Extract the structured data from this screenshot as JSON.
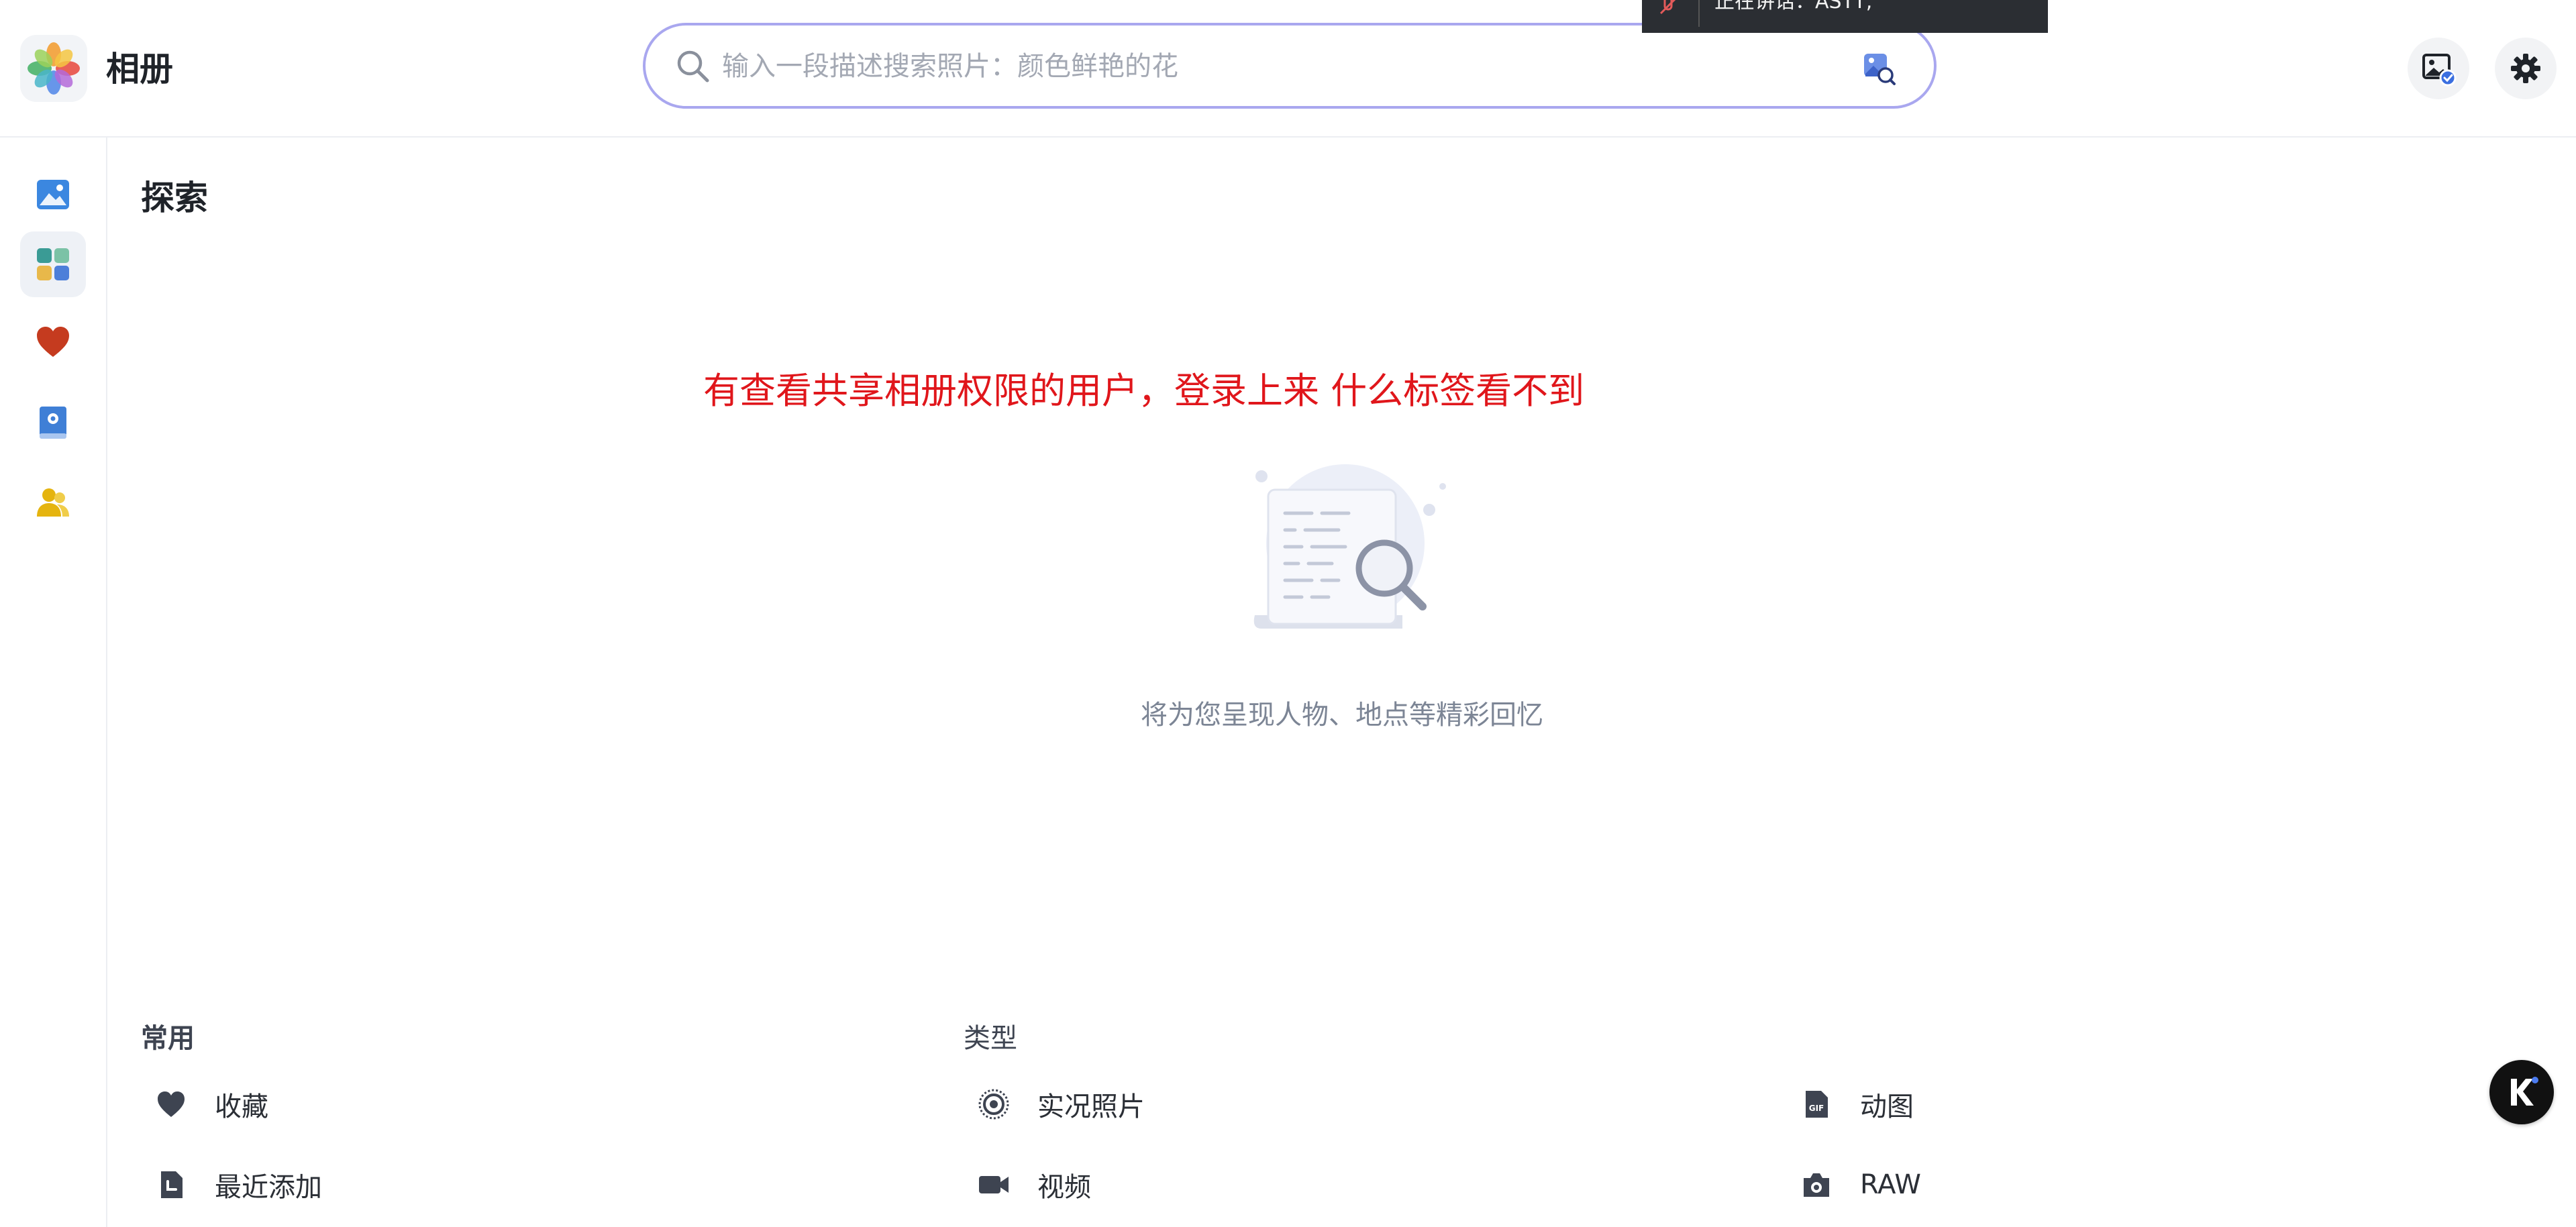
{
  "app": {
    "title": "相册"
  },
  "search": {
    "placeholder": "输入一段描述搜索照片：颜色鲜艳的花",
    "value": ""
  },
  "popup": {
    "text": "正在讲话：ASTT;"
  },
  "sidebar": {
    "items": [
      {
        "name": "photos",
        "icon": "image-icon",
        "color": "#3b87e0",
        "active": false
      },
      {
        "name": "explore",
        "icon": "grid-icon",
        "color": "#3a9b95",
        "active": true
      },
      {
        "name": "favorites",
        "icon": "heart-icon",
        "color": "#c53b1f",
        "active": false
      },
      {
        "name": "albums",
        "icon": "album-book-icon",
        "color": "#3f7fd6",
        "active": false
      },
      {
        "name": "people",
        "icon": "people-icon",
        "color": "#e5b40f",
        "active": false
      }
    ]
  },
  "page": {
    "title": "探索",
    "annotation": "有查看共享相册权限的用户，登录上来 什么标签看不到",
    "empty_text": "将为您呈现人物、地点等精彩回忆"
  },
  "sections": {
    "common": {
      "title": "常用",
      "items": [
        {
          "label": "收藏",
          "icon": "heart-icon"
        },
        {
          "label": "最近添加",
          "icon": "recent-file-icon"
        }
      ]
    },
    "types": {
      "title": "类型",
      "items": [
        {
          "label": "实况照片",
          "icon": "live-photo-icon"
        },
        {
          "label": "视频",
          "icon": "video-camera-icon"
        },
        {
          "label": "动图",
          "icon": "gif-file-icon"
        },
        {
          "label": "RAW",
          "icon": "camera-icon"
        }
      ]
    }
  },
  "colors": {
    "accent": "#a9a7ef",
    "annotation": "#e0161b",
    "icon_dark": "#3e4451"
  }
}
